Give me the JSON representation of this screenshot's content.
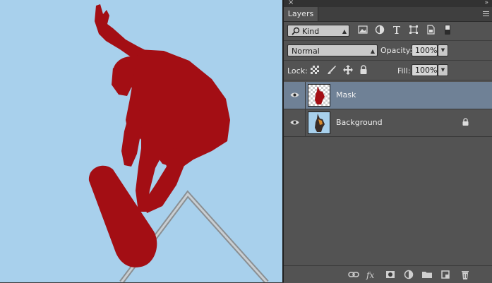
{
  "panel": {
    "close_glyph": "×",
    "collapse_glyph": "»",
    "tab_title": "Layers",
    "menu_icon": "panel-menu-icon"
  },
  "filter": {
    "kind_label": "Kind",
    "icons": [
      "pixel-layer-filter-icon",
      "adjustment-layer-filter-icon",
      "type-layer-filter-icon",
      "shape-layer-filter-icon",
      "smart-object-filter-icon",
      "filter-toggle-icon"
    ]
  },
  "blend": {
    "mode": "Normal",
    "opacity_label": "Opacity:",
    "opacity_value": "100%"
  },
  "lock": {
    "label": "Lock:",
    "fill_label": "Fill:",
    "fill_value": "100%",
    "icons": [
      "lock-transparent-pixels-icon",
      "lock-image-pixels-icon",
      "lock-position-icon",
      "lock-all-icon"
    ]
  },
  "layers": [
    {
      "name": "Mask",
      "selected": true,
      "visible": true,
      "locked": false
    },
    {
      "name": "Background",
      "selected": false,
      "visible": true,
      "locked": true
    }
  ],
  "bottom_icons": [
    "link-layers-icon",
    "fx-icon",
    "add-mask-icon",
    "adjustment-layer-icon",
    "new-group-icon",
    "new-layer-icon",
    "trash-icon"
  ],
  "colors": {
    "canvas_bg": "#a8d0ec",
    "silhouette": "#a30e14",
    "selected_layer": "#6f8196",
    "panel_bg": "#535353"
  }
}
